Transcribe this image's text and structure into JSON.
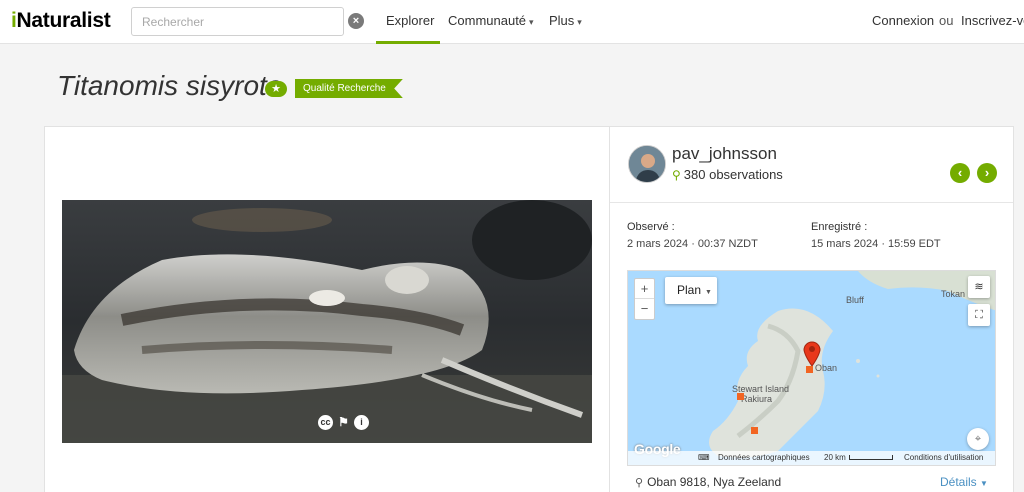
{
  "header": {
    "logo_i": "i",
    "logo_rest": "Naturalist",
    "search_placeholder": "Rechercher",
    "nav": {
      "explore": "Explorer",
      "community": "Communauté",
      "more": "Plus"
    },
    "login": "Connexion",
    "or": "ou",
    "signup": "Inscrivez-vo"
  },
  "title": {
    "species": "Titanomis sisyrota",
    "quality": "Qualité Recherche"
  },
  "observer": {
    "username": "pav_johnsson",
    "observations": "380 observations"
  },
  "dates": {
    "observed_label": "Observé :",
    "observed_value": "2 mars 2024 · 00:37 NZDT",
    "recorded_label": "Enregistré :",
    "recorded_value": "15 mars 2024 · 15:59 EDT"
  },
  "map": {
    "type_select": "Plan",
    "labels": {
      "bluff": "Bluff",
      "tokan": "Tokan",
      "oban": "Oban",
      "stewart": "Stewart Island",
      "rakiura": "Rakiura"
    },
    "attribution": {
      "google": "Google",
      "data": "Données cartographiques",
      "scale": "20 km",
      "terms": "Conditions d'utilisation"
    }
  },
  "location": {
    "place": "Oban 9818, Nya Zeeland",
    "details": "Détails"
  },
  "colors": {
    "brand_green": "#74ac00",
    "link_blue": "#4a90c2",
    "map_water": "#aadaff",
    "marker_red": "#e8381b",
    "observation_square": "#f26522"
  }
}
